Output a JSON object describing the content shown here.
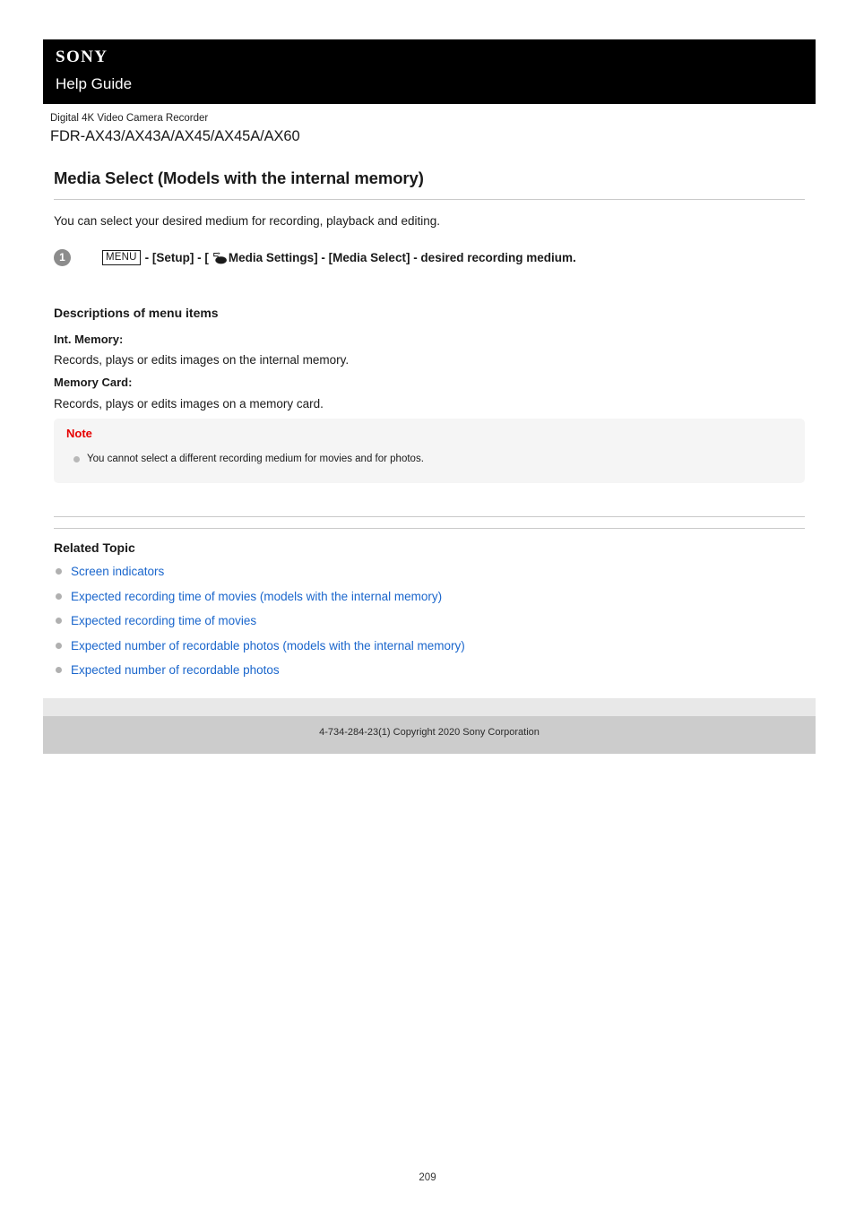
{
  "header": {
    "brand": "SONY",
    "guide_label": "Help Guide"
  },
  "product": {
    "category": "Digital 4K Video Camera Recorder",
    "model": "FDR-AX43/AX43A/AX45/AX45A/AX60"
  },
  "article": {
    "title": "Media Select (Models with the internal memory)",
    "intro": "You can select your desired medium for recording, playback and editing."
  },
  "step": {
    "number": "1",
    "menu_key": "MENU",
    "text_before_icon": " - [Setup] - [",
    "icon_name": "media-settings-icon",
    "text_after_icon": "Media Settings] - [Media Select] - desired recording medium."
  },
  "descriptions": {
    "heading": "Descriptions of menu items",
    "items": [
      {
        "term": "Int. Memory:",
        "definition": "Records, plays or edits images on the internal memory."
      },
      {
        "term": "Memory Card:",
        "definition": "Records, plays or edits images on a memory card."
      }
    ]
  },
  "note": {
    "title": "Note",
    "color": "#e60000",
    "items": [
      "You cannot select a different recording medium for movies and for photos."
    ]
  },
  "related": {
    "heading": "Related Topic",
    "link_color": "#1a66cc",
    "links": [
      "Screen indicators",
      "Expected recording time of movies (models with the internal memory)",
      "Expected recording time of movies",
      "Expected number of recordable photos (models with the internal memory)",
      "Expected number of recordable photos"
    ]
  },
  "footer": {
    "copyright": "4-734-284-23(1) Copyright 2020 Sony Corporation"
  },
  "page": {
    "number": "209"
  }
}
